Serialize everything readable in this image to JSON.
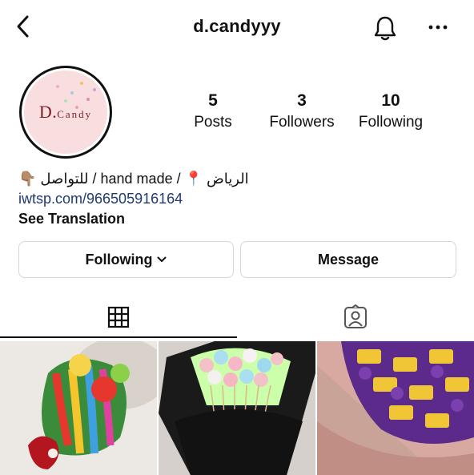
{
  "header": {
    "username": "d.candyyy"
  },
  "profile": {
    "logo_main": "D.",
    "logo_sub": "Candy",
    "stats": [
      {
        "value": "5",
        "label": "Posts"
      },
      {
        "value": "3",
        "label": "Followers"
      },
      {
        "value": "10",
        "label": "Following"
      }
    ]
  },
  "bio": {
    "line1": "الرياض 📍 / hand made / للتواصل 👇🏽",
    "link": "iwtsp.com/966505916164",
    "see_translation": "See Translation"
  },
  "actions": {
    "following_label": "Following",
    "message_label": "Message"
  },
  "tabs": {
    "grid_icon": "grid-icon",
    "tagged_icon": "tagged-person-icon"
  },
  "colors": {
    "link": "#1e3a73",
    "logo_bg": "#f9dedf",
    "logo_text": "#7a1d24"
  }
}
